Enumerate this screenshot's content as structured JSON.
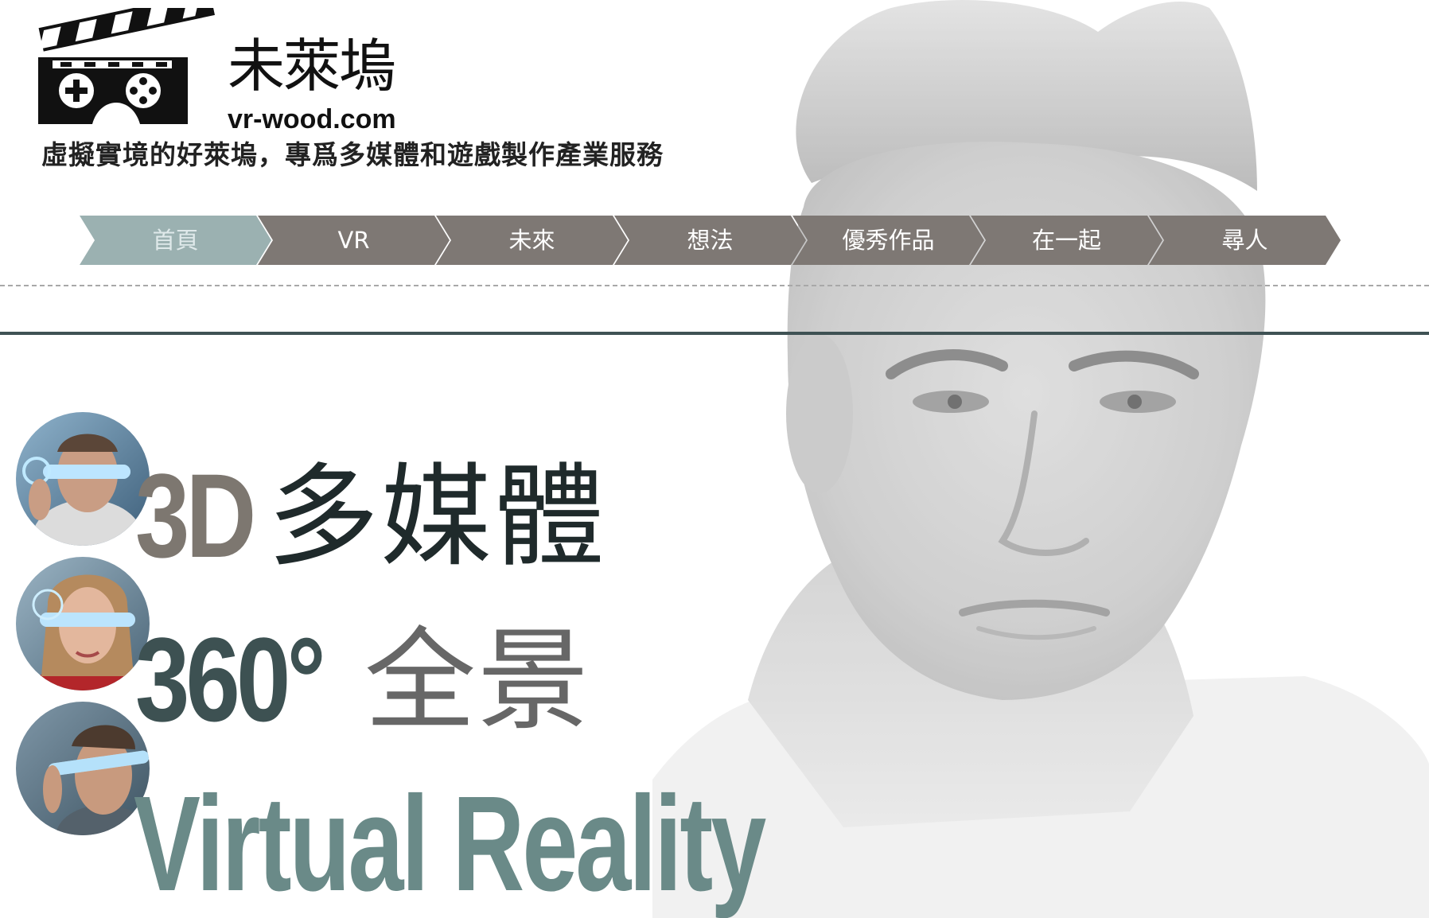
{
  "colors": {
    "nav_active": "#9bb1b1",
    "nav_default": "#7e7874",
    "divider": "#3f5254",
    "accent_teal": "#6a8a88",
    "text_dark": "#1f2a2b"
  },
  "header": {
    "logo_icon": "clapperboard-vr-goggles-icon",
    "logo_name": "未萊塢",
    "logo_domain": "vr-wood.com",
    "tagline": "虛擬實境的好萊塢，專爲多媒體和遊戲製作產業服務"
  },
  "nav": {
    "items": [
      {
        "label": "首頁",
        "active": true
      },
      {
        "label": "VR",
        "active": false
      },
      {
        "label": "未來",
        "active": false
      },
      {
        "label": "想法",
        "active": false
      },
      {
        "label": "優秀作品",
        "active": false
      },
      {
        "label": "在一起",
        "active": false
      },
      {
        "label": "尋人",
        "active": false
      }
    ]
  },
  "hero": {
    "background_image": "portrait-man-grayscale",
    "thumbnails": [
      {
        "name": "man-vr-visor-thumbnail"
      },
      {
        "name": "woman-vr-visor-thumbnail"
      },
      {
        "name": "man-vr-glasses-thumbnail"
      }
    ],
    "line1_a": "3D",
    "line1_b": "多媒體",
    "line2_a": "360°",
    "line2_b": "全景",
    "line3": "Virtual Reality"
  }
}
